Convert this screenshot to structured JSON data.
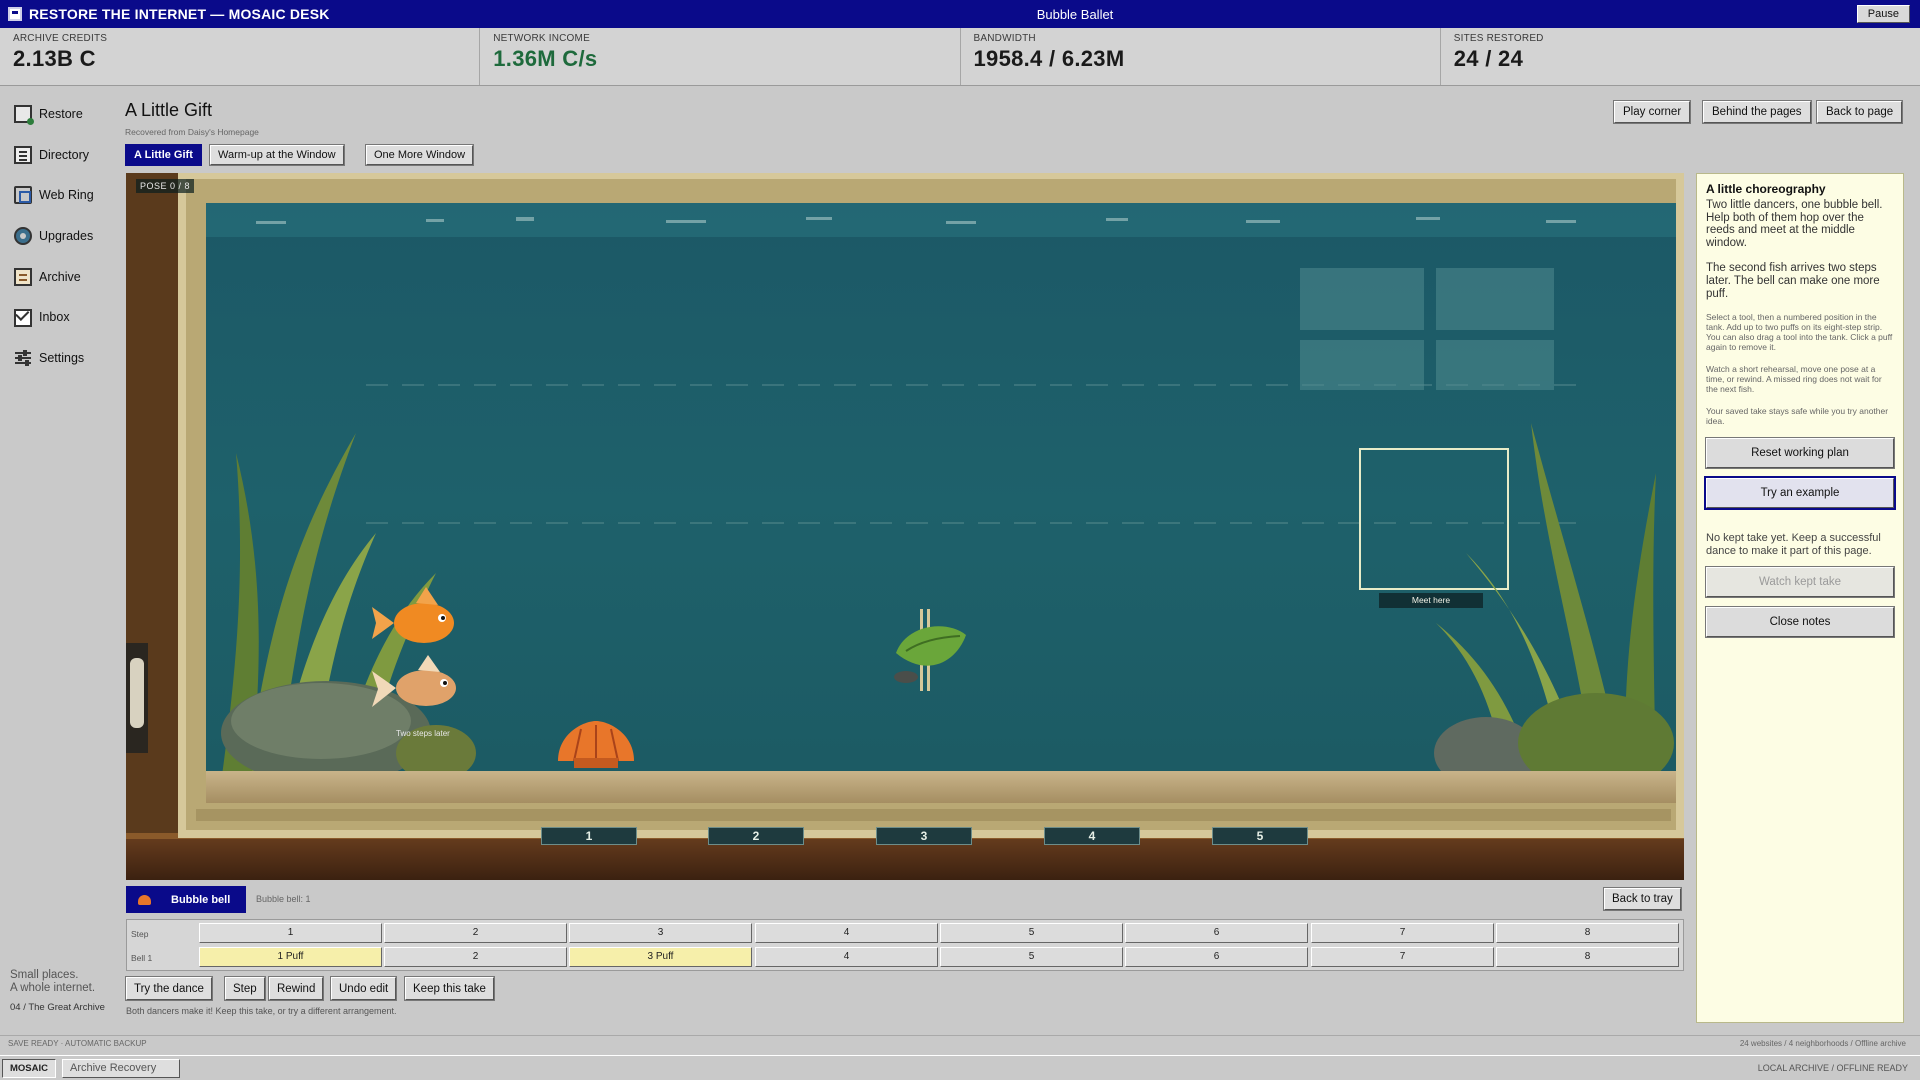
{
  "titlebar": {
    "app_title": "RESTORE THE INTERNET — MOSAIC DESK",
    "game_title": "Bubble Ballet",
    "pause_label": "Pause"
  },
  "stats": [
    {
      "label": "ARCHIVE CREDITS",
      "value": "2.13B C"
    },
    {
      "label": "NETWORK INCOME",
      "value": "1.36M C/s"
    },
    {
      "label": "BANDWIDTH",
      "value": "1958.4 / 6.23M"
    },
    {
      "label": "SITES RESTORED",
      "value": "24 / 24"
    }
  ],
  "sidebar": {
    "items": [
      {
        "label": "Restore",
        "icon": "restore-icon"
      },
      {
        "label": "Directory",
        "icon": "directory-icon"
      },
      {
        "label": "Web Ring",
        "icon": "web-ring-icon"
      },
      {
        "label": "Upgrades",
        "icon": "upgrades-icon"
      },
      {
        "label": "Archive",
        "icon": "archive-icon"
      },
      {
        "label": "Inbox",
        "icon": "inbox-icon"
      },
      {
        "label": "Settings",
        "icon": "settings-icon"
      }
    ],
    "tagline_1": "Small places.",
    "tagline_2": "A whole internet.",
    "chapter": "04 / The Great Archive"
  },
  "header": {
    "title": "A Little Gift",
    "subtitle": "Recovered from Daisy's Homepage",
    "buttons": [
      "Play corner",
      "Behind the pages",
      "Back to page"
    ],
    "tabs": [
      "A Little Gift",
      "Warm-up at the Window",
      "One More Window"
    ],
    "active_tab": "A Little Gift"
  },
  "scene": {
    "pose_counter": "POSE 0 / 8",
    "second_fish_note": "Two steps later",
    "meet_label": "Meet here",
    "slots": [
      "1",
      "2",
      "3",
      "4",
      "5"
    ]
  },
  "notes": {
    "title": "A little choreography",
    "p1": "Two little dancers, one bubble bell. Help both of them hop over the reeds and meet at the middle window.",
    "p2": "The second fish arrives two steps later. The bell can make one more puff.",
    "s1": "Select a tool, then a numbered position in the tank. Add up to two puffs on its eight-step strip. You can also drag a tool into the tank. Click a puff again to remove it.",
    "s2": "Watch a short rehearsal, move one pose at a time, or rewind. A missed ring does not wait for the next fish.",
    "s3": "Your saved take stays safe while you try another idea.",
    "reset_label": "Reset working plan",
    "example_label": "Try an example",
    "kept_note": "No kept take yet. Keep a successful dance to make it part of this page.",
    "watch_label": "Watch kept take",
    "close_label": "Close notes"
  },
  "tray": {
    "tool_label": "Bubble bell",
    "tool_count": "Bubble bell: 1",
    "back_label": "Back to tray",
    "step_label": "Step",
    "bell_label": "Bell 1",
    "steps": [
      "1",
      "2",
      "3",
      "4",
      "5",
      "6",
      "7",
      "8"
    ],
    "bell_cells": [
      "1 Puff",
      "2",
      "3 Puff",
      "4",
      "5",
      "6",
      "7",
      "8"
    ],
    "puff_steps": [
      1,
      3
    ]
  },
  "actions": {
    "buttons": [
      "Try the dance",
      "Step",
      "Rewind",
      "Undo edit",
      "Keep this take"
    ],
    "status": "Both dancers make it! Keep this take, or try a different arrangement."
  },
  "footer": {
    "save_status": "SAVE READY · AUTOMATIC BACKUP",
    "summary": "24 websites / 4 neighborhoods / Offline archive",
    "mosaic_label": "MOSAIC",
    "window_label": "Archive Recovery",
    "tray_status": "LOCAL ARCHIVE / OFFLINE READY"
  },
  "colors": {
    "title_bar": "#0a0a8a",
    "income_green": "#1e6a3c",
    "water": "#1d5f69",
    "puff_cell": "#f6efaa"
  }
}
